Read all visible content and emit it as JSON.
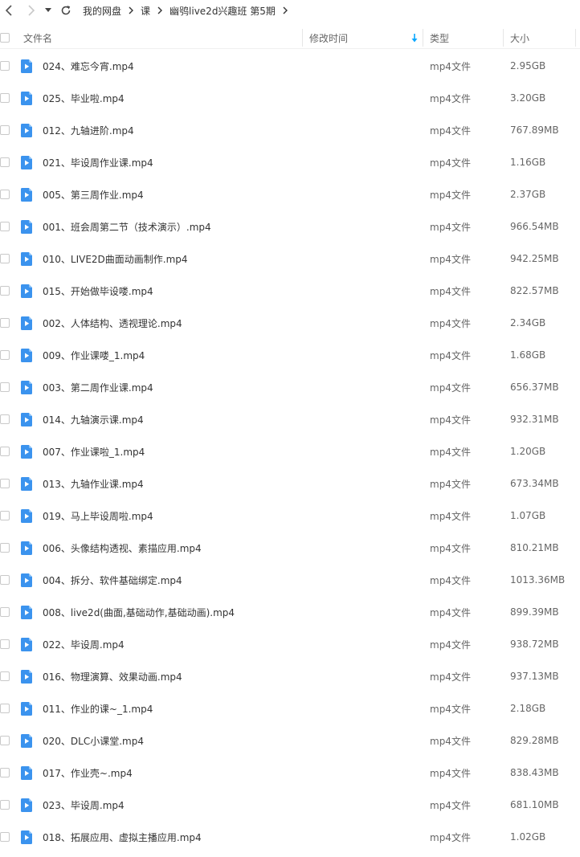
{
  "breadcrumb": {
    "items": [
      "我的网盘",
      "课",
      "幽鸮live2d兴趣班 第5期"
    ]
  },
  "colors": {
    "accent": "#06a7ff",
    "icon_blue": "#3b93ee",
    "text": "#333333",
    "muted": "#666666",
    "border": "#e6e6e6"
  },
  "icons": {
    "back": "chevron-left-icon",
    "forward": "chevron-right-icon",
    "dropdown": "caret-down-icon",
    "refresh": "refresh-icon",
    "separator": "chevron-right-icon",
    "file": "video-file-icon",
    "sort": "sort-down-arrow-icon"
  },
  "columns": {
    "name": "文件名",
    "modified": "修改时间",
    "type": "类型",
    "size": "大小"
  },
  "files": [
    {
      "name": "024、难忘今宵.mp4",
      "type": "mp4文件",
      "size": "2.95GB"
    },
    {
      "name": "025、毕业啦.mp4",
      "type": "mp4文件",
      "size": "3.20GB"
    },
    {
      "name": "012、九轴进阶.mp4",
      "type": "mp4文件",
      "size": "767.89MB"
    },
    {
      "name": "021、毕设周作业课.mp4",
      "type": "mp4文件",
      "size": "1.16GB"
    },
    {
      "name": "005、第三周作业.mp4",
      "type": "mp4文件",
      "size": "2.37GB"
    },
    {
      "name": "001、班会周第二节（技术演示）.mp4",
      "type": "mp4文件",
      "size": "966.54MB"
    },
    {
      "name": "010、LIVE2D曲面动画制作.mp4",
      "type": "mp4文件",
      "size": "942.25MB"
    },
    {
      "name": "015、开始做毕设喽.mp4",
      "type": "mp4文件",
      "size": "822.57MB"
    },
    {
      "name": "002、人体结构、透视理论.mp4",
      "type": "mp4文件",
      "size": "2.34GB"
    },
    {
      "name": "009、作业课喽_1.mp4",
      "type": "mp4文件",
      "size": "1.68GB"
    },
    {
      "name": "003、第二周作业课.mp4",
      "type": "mp4文件",
      "size": "656.37MB"
    },
    {
      "name": "014、九轴演示课.mp4",
      "type": "mp4文件",
      "size": "932.31MB"
    },
    {
      "name": "007、作业课啦_1.mp4",
      "type": "mp4文件",
      "size": "1.20GB"
    },
    {
      "name": "013、九轴作业课.mp4",
      "type": "mp4文件",
      "size": "673.34MB"
    },
    {
      "name": "019、马上毕设周啦.mp4",
      "type": "mp4文件",
      "size": "1.07GB"
    },
    {
      "name": "006、头像结构透视、素描应用.mp4",
      "type": "mp4文件",
      "size": "810.21MB"
    },
    {
      "name": "004、拆分、软件基础绑定.mp4",
      "type": "mp4文件",
      "size": "1013.36MB"
    },
    {
      "name": "008、live2d(曲面,基础动作,基础动画).mp4",
      "type": "mp4文件",
      "size": "899.39MB"
    },
    {
      "name": "022、毕设周.mp4",
      "type": "mp4文件",
      "size": "938.72MB"
    },
    {
      "name": "016、物理演算、效果动画.mp4",
      "type": "mp4文件",
      "size": "937.13MB"
    },
    {
      "name": "011、作业的课~_1.mp4",
      "type": "mp4文件",
      "size": "2.18GB"
    },
    {
      "name": "020、DLC小课堂.mp4",
      "type": "mp4文件",
      "size": "829.28MB"
    },
    {
      "name": "017、作业壳~.mp4",
      "type": "mp4文件",
      "size": "838.43MB"
    },
    {
      "name": "023、毕设周.mp4",
      "type": "mp4文件",
      "size": "681.10MB"
    },
    {
      "name": "018、拓展应用、虚拟主播应用.mp4",
      "type": "mp4文件",
      "size": "1.02GB"
    }
  ]
}
